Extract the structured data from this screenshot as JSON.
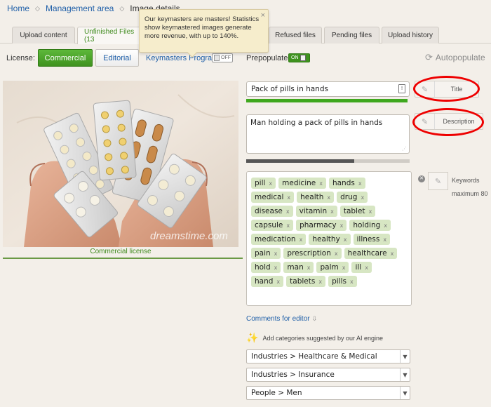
{
  "breadcrumb": {
    "home": "Home",
    "management": "Management area",
    "current": "Image details"
  },
  "tabs": [
    {
      "label": "Upload content"
    },
    {
      "label": "Unfinished Files (13"
    },
    {
      "label": "Refused files"
    },
    {
      "label": "Pending files"
    },
    {
      "label": "Upload history"
    }
  ],
  "tooltip": {
    "text": "Our keymasters are masters! Statistics show keymastered images generate more revenue, with up to 140%.",
    "close": "×"
  },
  "license": {
    "label": "License:",
    "commercial": "Commercial",
    "editorial": "Editorial",
    "keymasters_link": "Keymasters Program",
    "keymasters_toggle": "OFF",
    "prepopulated_label": "Prepopulated",
    "prepopulated_toggle": "ON",
    "autopopulate": "Autopopulate"
  },
  "image": {
    "caption": "Commercial license",
    "watermark": "dreamstime.com"
  },
  "title_field": {
    "value": "Pack of pills in hands",
    "button_label": "Title"
  },
  "description_field": {
    "value": "Man holding a pack of pills in hands",
    "button_label": "Description",
    "progress": 0.66
  },
  "keywords": {
    "items": [
      "pill",
      "medicine",
      "hands",
      "medical",
      "health",
      "drug",
      "disease",
      "vitamin",
      "tablet",
      "capsule",
      "pharmacy",
      "holding",
      "medication",
      "healthy",
      "illness",
      "pain",
      "prescription",
      "healthcare",
      "hold",
      "man",
      "palm",
      "ill",
      "hand",
      "tablets",
      "pills"
    ],
    "remove_symbol": "x",
    "button_label": "Keywords",
    "max_label": "maximum 80"
  },
  "comments": {
    "label": "Comments for editor"
  },
  "ai": {
    "label": "Add categories suggested by our AI engine"
  },
  "categories": [
    {
      "value": "Industries > Healthcare & Medical"
    },
    {
      "value": "Industries > Insurance"
    },
    {
      "value": "People > Men"
    }
  ],
  "colors": {
    "accent_green": "#3f921f",
    "link_blue": "#1f5fa8",
    "highlight_red": "#e00000",
    "keyword_bg": "#d7e6c3"
  }
}
